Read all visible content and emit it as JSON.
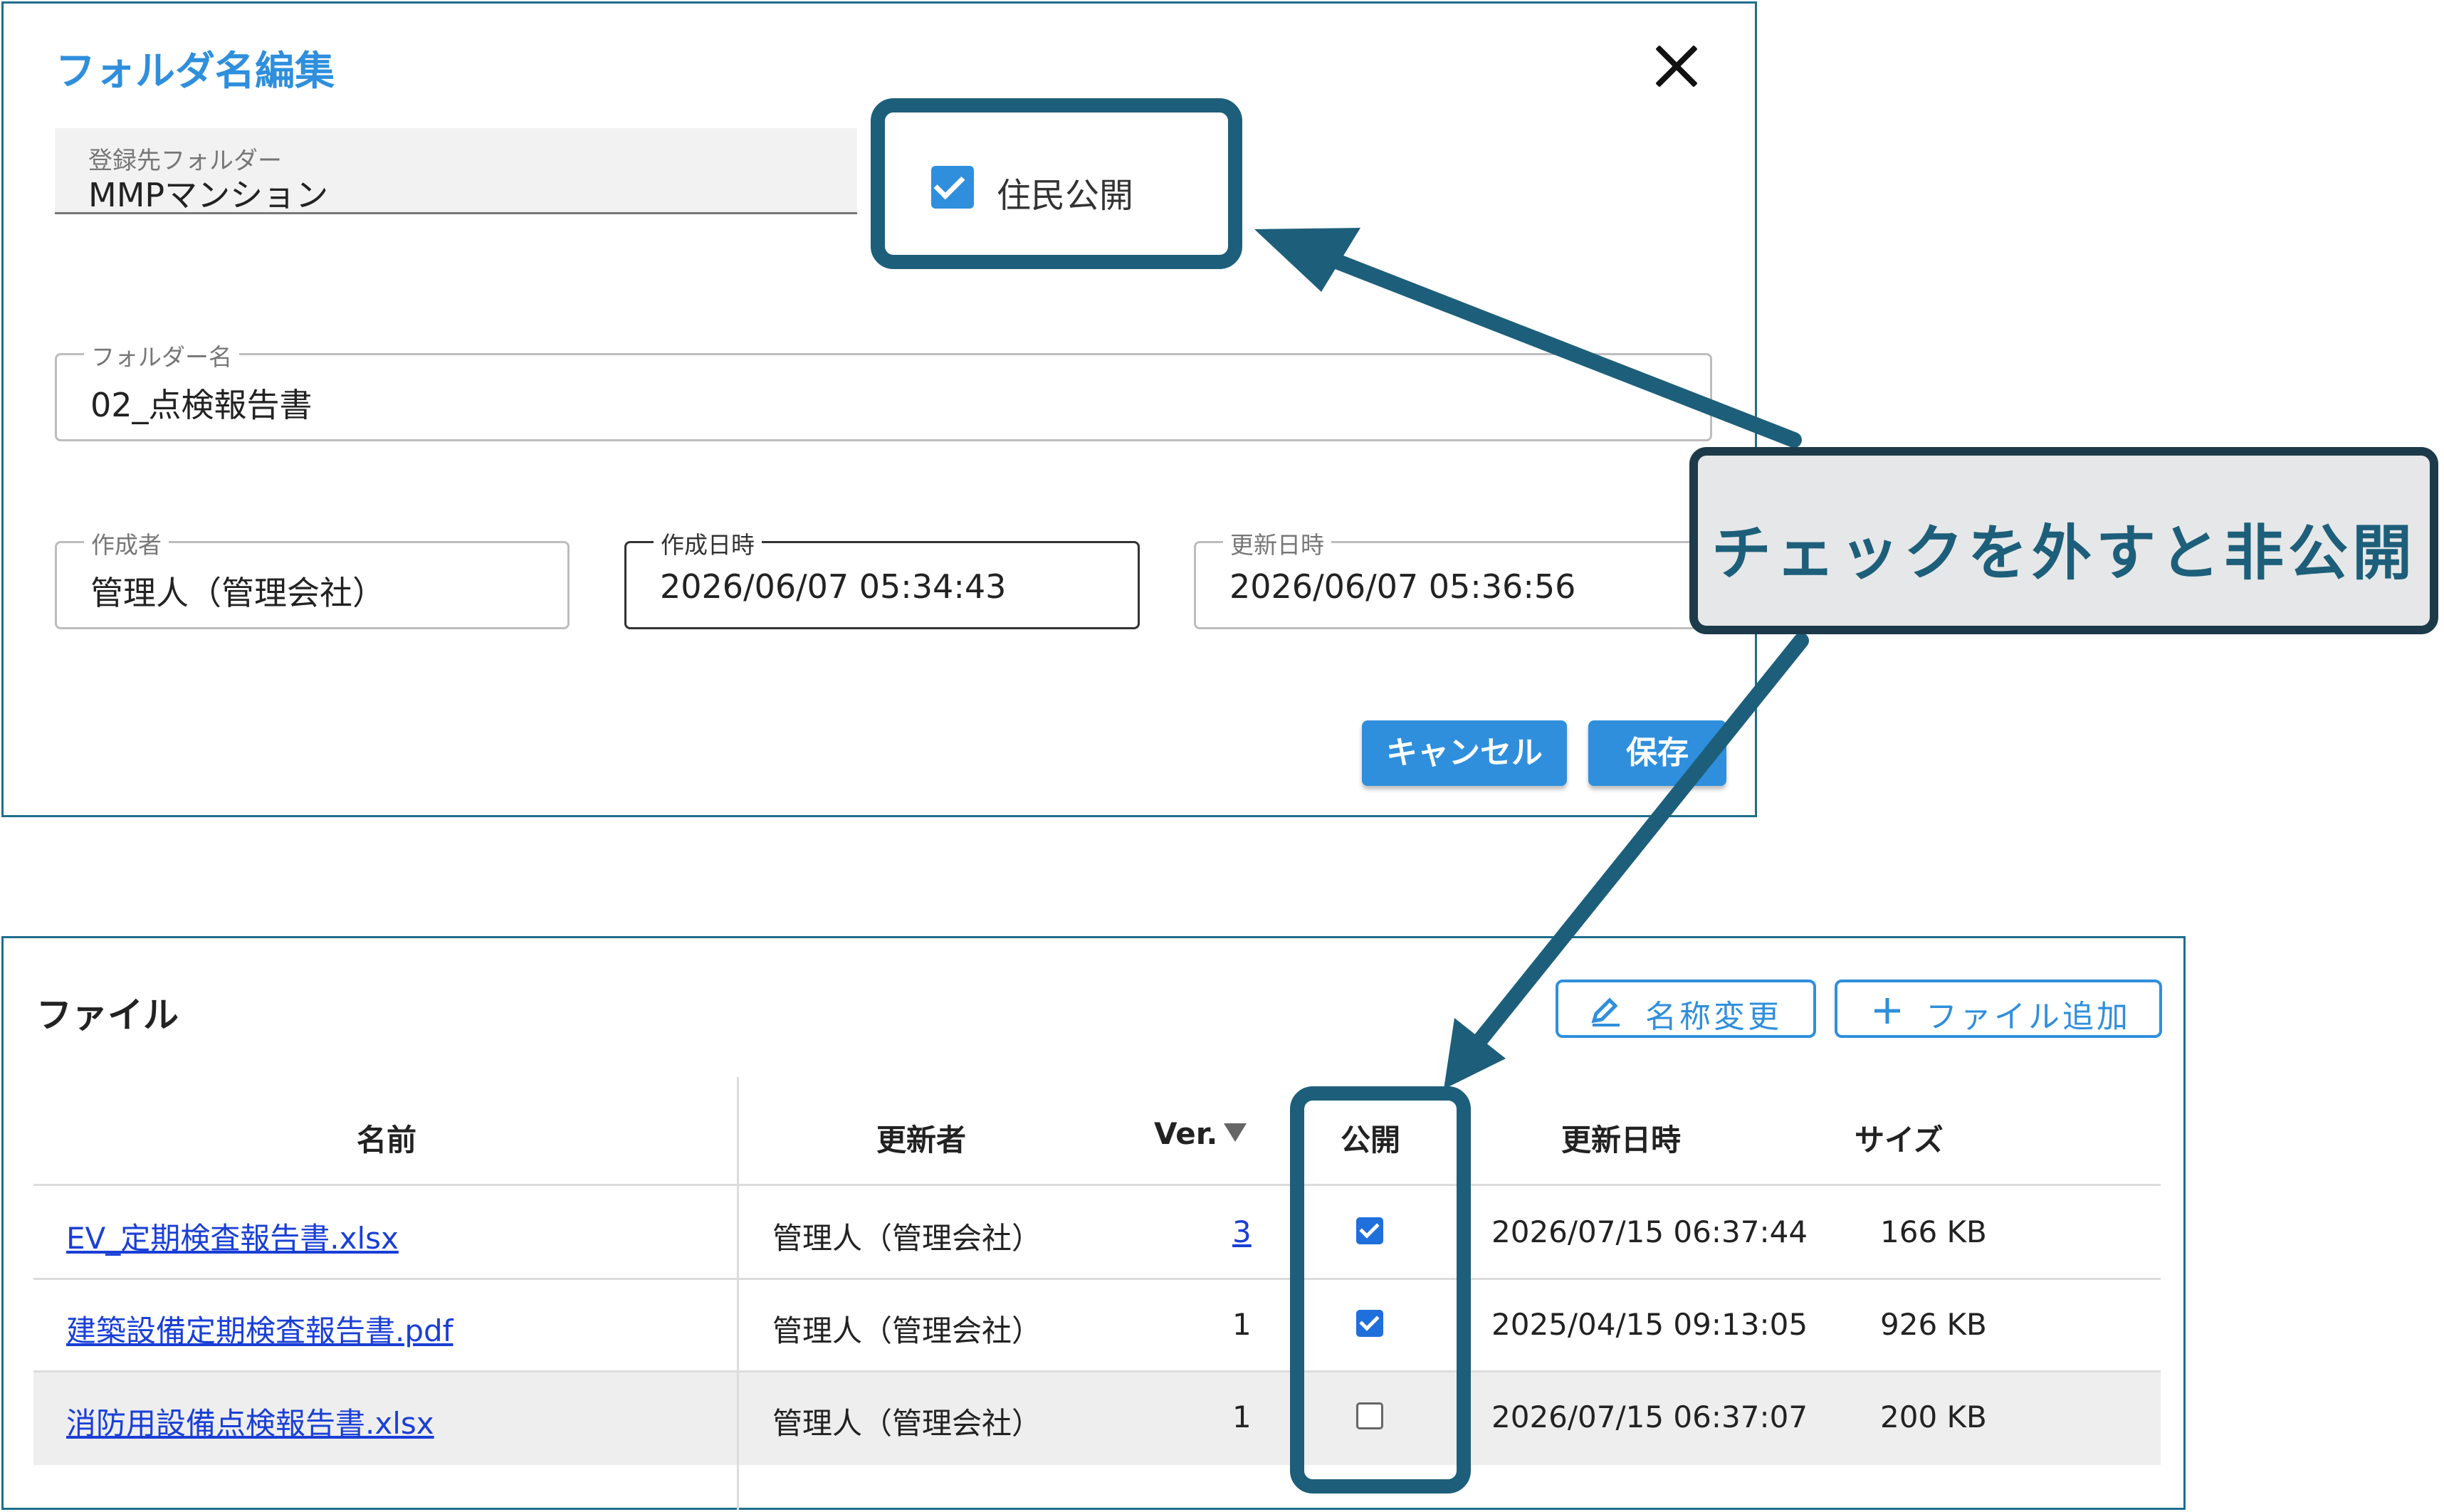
{
  "dialog": {
    "title": "フォルダ名編集",
    "registered_folder": {
      "label": "登録先フォルダー",
      "value": "MMPマンション"
    },
    "public_checkbox": {
      "label": "住民公開",
      "checked": true
    },
    "folder_name": {
      "label": "フォルダー名",
      "value": "02_点検報告書"
    },
    "creator": {
      "label": "作成者",
      "value": "管理人（管理会社）"
    },
    "created_at": {
      "label": "作成日時",
      "value": "2026/06/07 05:34:43"
    },
    "updated_at": {
      "label": "更新日時",
      "value": "2026/06/07 05:36:56"
    },
    "cancel_label": "キャンセル",
    "save_label": "保存"
  },
  "callout": {
    "text": "チェックを外すと非公開"
  },
  "file_panel": {
    "title": "ファイル",
    "rename_label": "名称変更",
    "add_file_label": "ファイル追加",
    "columns": {
      "name": "名前",
      "updater": "更新者",
      "ver": "Ver.",
      "public": "公開",
      "updated": "更新日時",
      "size": "サイズ"
    },
    "rows": [
      {
        "name": "EV_定期検査報告書.xlsx",
        "updater": "管理人（管理会社）",
        "ver": "3",
        "public": true,
        "updated": "2026/07/15 06:37:44",
        "size": "166 KB"
      },
      {
        "name": "建築設備定期検査報告書.pdf",
        "updater": "管理人（管理会社）",
        "ver": "1",
        "public": true,
        "updated": "2025/04/15 09:13:05",
        "size": "926 KB"
      },
      {
        "name": "消防用設備点検報告書.xlsx",
        "updater": "管理人（管理会社）",
        "ver": "1",
        "public": false,
        "updated": "2026/07/15 06:37:07",
        "size": "200 KB"
      }
    ]
  },
  "colors": {
    "accent": "#2f8fdc",
    "annotation": "#1d5f7a",
    "link": "#1a3fd6"
  }
}
